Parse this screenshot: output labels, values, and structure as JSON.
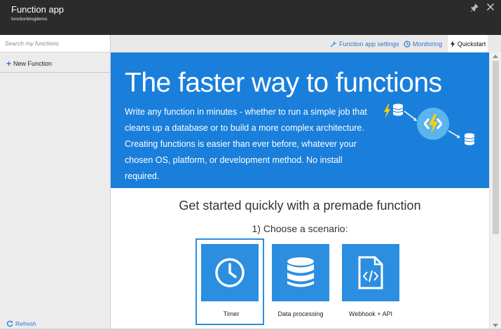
{
  "window": {
    "title": "Function app",
    "subtitle": "functionblogdemo",
    "pin_icon": "pin-icon",
    "close_icon": "close-icon"
  },
  "sidebar": {
    "search_placeholder": "Search my functions",
    "new_function_label": "New Function",
    "refresh_label": "Refresh"
  },
  "nav": {
    "settings_label": "Function app settings",
    "monitoring_label": "Monitoring",
    "quickstart_label": "Quickstart"
  },
  "hero": {
    "title": "The faster way to functions",
    "description": "Write any function in minutes - whether to run a simple job that cleans up a database or to build a more complex architecture. Creating functions is easier than ever before, whatever your chosen OS, platform, or development method. No install required."
  },
  "main": {
    "heading": "Get started quickly with a premade function",
    "subheading": "1) Choose a scenario:",
    "scenarios": [
      {
        "label": "Timer",
        "icon": "clock-icon",
        "selected": true
      },
      {
        "label": "Data processing",
        "icon": "database-icon",
        "selected": false
      },
      {
        "label": "Webhook + API",
        "icon": "code-file-icon",
        "selected": false
      }
    ]
  },
  "colors": {
    "titlebar": "#2b2b2b",
    "accent": "#1a7fdb",
    "tile": "#2b8ee0",
    "link": "#2f78cf"
  }
}
